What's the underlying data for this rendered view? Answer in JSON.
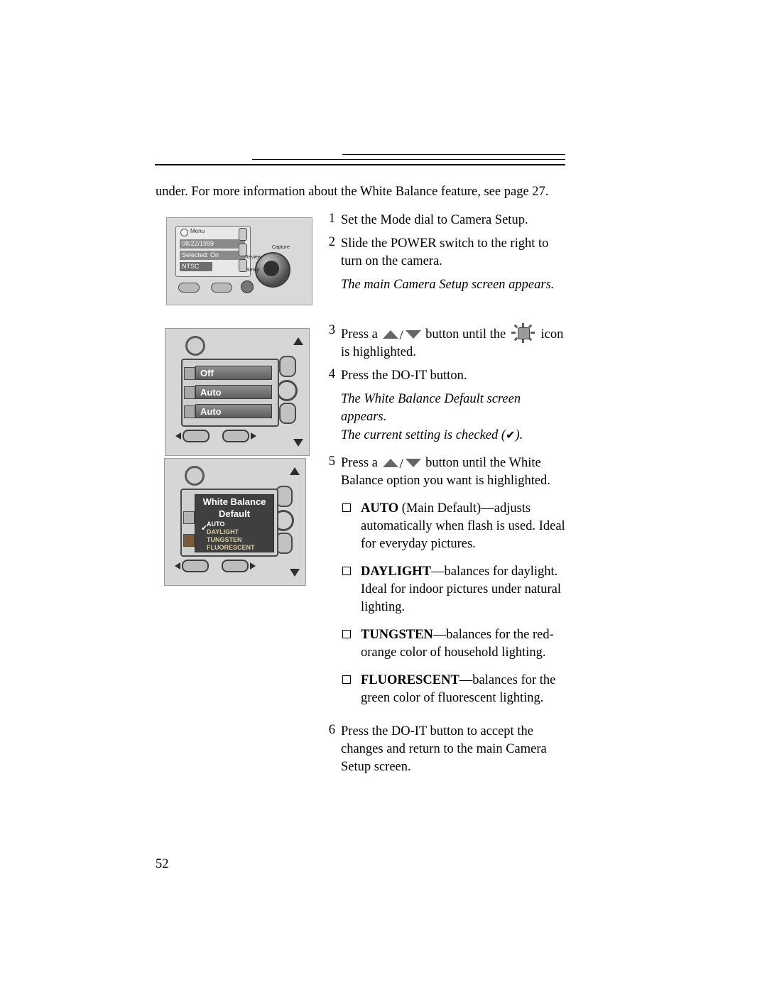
{
  "page": {
    "number": "52",
    "intro": "under. For more information about the White Balance feature, see page 27."
  },
  "steps": [
    {
      "num": "1",
      "text": "Set the Mode dial to Camera Setup."
    },
    {
      "num": "2",
      "text": "Slide the POWER switch to the right to turn on the camera.",
      "note": "The main Camera Setup screen appears."
    },
    {
      "num": "3",
      "text_before": "Press a",
      "text_mid": "button until the",
      "text_after": "icon is highlighted."
    },
    {
      "num": "4",
      "text": "Press the DO-IT button.",
      "note_line1": "The White Balance Default screen appears.",
      "note_line2_before": "The current setting is checked (",
      "note_check": "✔",
      "note_line2_after": ")."
    },
    {
      "num": "5",
      "text_before": "Press a",
      "text_after": "button until the White Balance option you want is highlighted."
    },
    {
      "num": "6",
      "text": "Press the DO-IT button to accept the changes and return to the main Camera Setup screen."
    }
  ],
  "options": [
    {
      "label": "AUTO (Main Default)",
      "bold_part": "AUTO",
      "paren_part": "(Main Default)",
      "desc": "—adjusts automatically when flash is used. Ideal for everyday pictures."
    },
    {
      "label": "DAYLIGHT",
      "desc": "—balances for daylight. Ideal for indoor pictures under natural lighting."
    },
    {
      "label": "TUNGSTEN",
      "desc": "—balances for the red-orange color of household lighting."
    },
    {
      "label": "FLUORESCENT",
      "desc": "—balances for the green color of fluorescent lighting."
    }
  ],
  "figure_camera_setup": {
    "menu_label": "Menu",
    "rows": [
      "08/22/1999",
      "Selected: On",
      "NTSC"
    ],
    "dial_labels": {
      "capture": "Capture",
      "review": "Review",
      "setup": "Setup"
    }
  },
  "figure_menu_screen": {
    "rows": [
      "Off",
      "Auto",
      "Auto"
    ]
  },
  "figure_white_balance": {
    "title_line1": "White Balance",
    "title_line2": "Default",
    "options": [
      "AUTO",
      "DAYLIGHT",
      "TUNGSTEN",
      "FLUORESCENT"
    ],
    "checked": "AUTO",
    "check_glyph": "✔"
  }
}
